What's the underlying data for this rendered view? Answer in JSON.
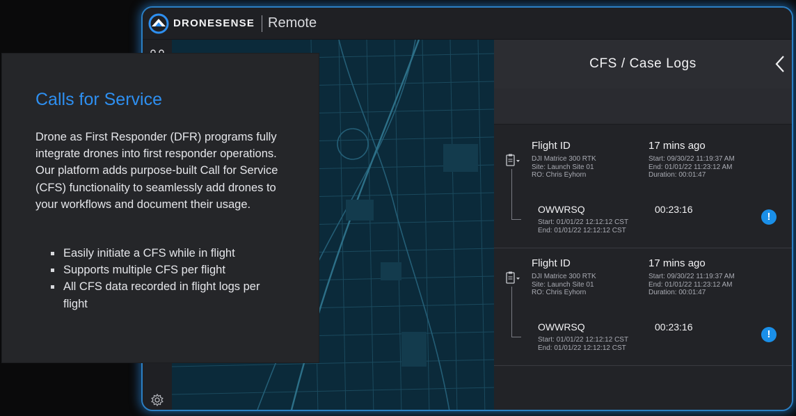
{
  "app": {
    "brand": "DRONESENSE",
    "product": "Remote"
  },
  "panel": {
    "title": "CFS / Case Logs"
  },
  "logs": [
    {
      "flight_label": "Flight ID",
      "time_ago": "17 mins ago",
      "aircraft": "DJI Matrice 300 RTK",
      "site": "Site: Launch Site 01",
      "ro": "RO: Chris Eyhorn",
      "start": "Start: 09/30/22 11:19:37 AM",
      "end": "End: 01/01/22 11:23:12 AM",
      "duration": "Duration: 00:01:47",
      "cfs": {
        "id": "OWWRSQ",
        "duration": "00:23:16",
        "start": "Start: 01/01/22 12:12:12 CST",
        "end": "End: 01/01/22 12:12:12 CST",
        "alert": "!"
      }
    },
    {
      "flight_label": "Flight ID",
      "time_ago": "17 mins ago",
      "aircraft": "DJI Matrice 300 RTK",
      "site": "Site: Launch Site 01",
      "ro": "RO: Chris Eyhorn",
      "start": "Start: 09/30/22 11:19:37 AM",
      "end": "End: 01/01/22 11:23:12 AM",
      "duration": "Duration: 00:01:47",
      "cfs": {
        "id": "OWWRSQ",
        "duration": "00:23:16",
        "start": "Start: 01/01/22 12:12:12 CST",
        "end": "End: 01/01/22 12:12:12 CST",
        "alert": "!"
      }
    }
  ],
  "card": {
    "title": "Calls for Service",
    "body": "Drone as First Responder (DFR) programs fully integrate drones into first responder operations. Our platform adds purpose-built Call for Service (CFS) functionality to seamlessly add drones to your workflows and document their usage.",
    "bullets": [
      "Easily initiate a CFS while in flight",
      "Supports multiple CFS per flight",
      "All CFS data recorded in flight logs per flight"
    ]
  },
  "colors": {
    "accent_blue": "#2e8ff0",
    "alert_blue": "#1a8fe8",
    "frame_glow": "#2b7fc4",
    "map_base": "#0b2a3a"
  },
  "icons": {
    "logo": "dronesense-logo-icon",
    "drone": "drone-icon",
    "settings": "gear-icon",
    "back": "chevron-left-icon",
    "clipboard": "clipboard-icon",
    "alert": "alert-icon"
  }
}
